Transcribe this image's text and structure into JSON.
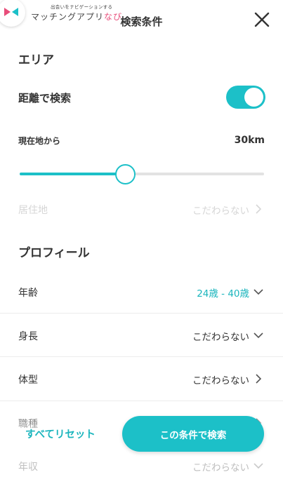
{
  "header": {
    "brand_tagline": "出会いをナビゲーションする",
    "brand_name": "マッチングアプリ",
    "brand_name_accent": "なび",
    "title": "検索条件",
    "close_icon": "close-icon"
  },
  "area": {
    "section_title": "エリア",
    "distance_search_label": "距離で検索",
    "distance_search_enabled": true,
    "from_current_label": "現在地から",
    "distance_value": "30km",
    "distance_slider_level": 0.43,
    "residence_label": "居住地",
    "residence_value": "こだわらない"
  },
  "profile": {
    "section_title": "プロフィール",
    "rows": [
      {
        "label": "年齢",
        "value": "24歳 - 40歳",
        "icon": "chevron-down-icon"
      },
      {
        "label": "身長",
        "value": "こだわらない",
        "icon": "chevron-down-icon"
      },
      {
        "label": "体型",
        "value": "こだわらない",
        "icon": "chevron-right-icon"
      },
      {
        "label": "職種",
        "value": "",
        "icon": "chevron-right-icon"
      },
      {
        "label": "年収",
        "value": "こだわらない",
        "icon": "chevron-down-icon"
      }
    ]
  },
  "footer": {
    "reset_label": "すべてリセット",
    "search_label": "この条件で検索"
  },
  "colors": {
    "accent": "#1cc0c8",
    "accent_text": "#1ab5bd",
    "brand_pink": "#e84d7a",
    "muted": "#d6d6d6"
  }
}
